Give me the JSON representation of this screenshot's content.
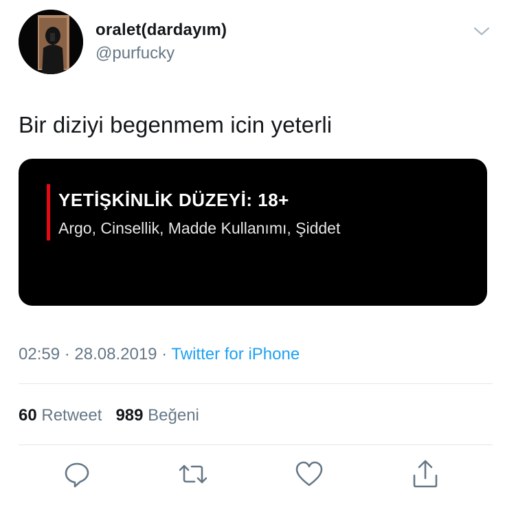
{
  "user": {
    "display_name": "oralet(dardayım)",
    "handle": "@purfucky"
  },
  "tweet": {
    "text": "Bir diziyi begenmem icin yeterli"
  },
  "media": {
    "rating_title": "YETİŞKİNLİK DÜZEYİ: 18+",
    "rating_description": "Argo, Cinsellik, Madde Kullanımı, Şiddet",
    "accent_color": "#e50914"
  },
  "meta": {
    "time": "02:59",
    "separator": " · ",
    "date": "28.08.2019",
    "source": "Twitter for iPhone"
  },
  "stats": {
    "retweet_count": "60",
    "retweet_label": "Retweet",
    "like_count": "989",
    "like_label": "Beğeni"
  },
  "actions": {
    "icons": [
      "reply-icon",
      "retweet-icon",
      "like-icon",
      "share-icon"
    ]
  },
  "colors": {
    "text": "#14171a",
    "secondary": "#657786",
    "link": "#1da1f2",
    "divider": "#e1e8ed"
  }
}
